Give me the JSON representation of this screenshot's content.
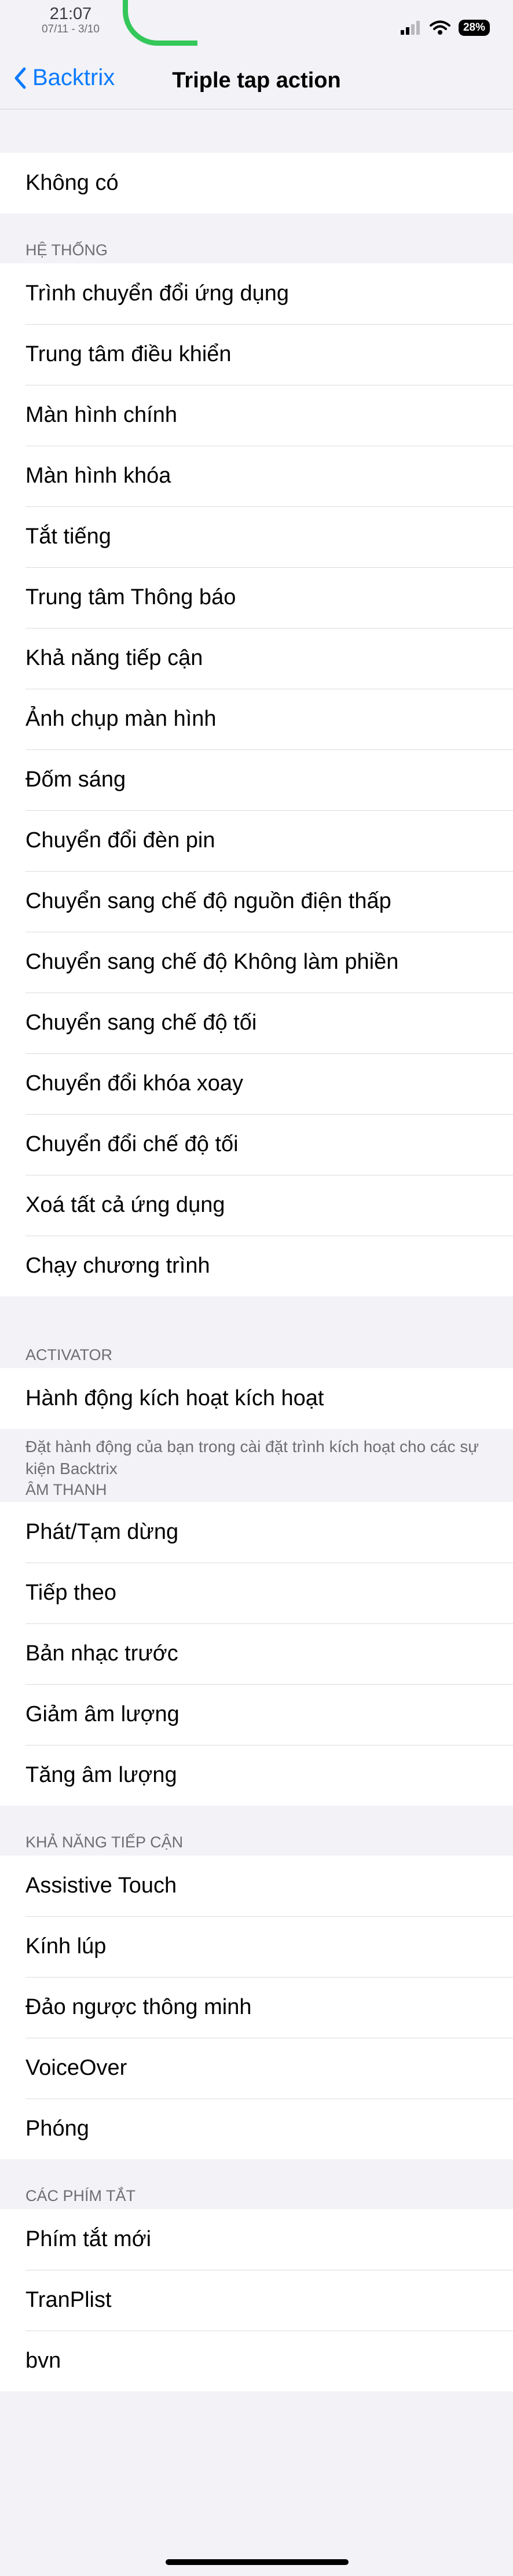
{
  "status_bar": {
    "time": "21:07",
    "date": "07/11 - 3/10",
    "battery": "28%"
  },
  "nav": {
    "back_label": "Backtrix",
    "title": "Triple tap action"
  },
  "top_group": {
    "items": [
      "Không có"
    ]
  },
  "sections": {
    "he_thong": {
      "header": "HỆ THỐNG",
      "items": [
        "Trình chuyển đổi ứng dụng",
        "Trung tâm điều khiển",
        "Màn hình chính",
        "Màn hình khóa",
        "Tắt tiếng",
        "Trung tâm Thông báo",
        "Khả năng tiếp cận",
        "Ảnh chụp màn hình",
        "Đốm sáng",
        "Chuyển đổi đèn pin",
        "Chuyển sang chế độ nguồn điện thấp",
        "Chuyển sang chế độ Không làm phiền",
        "Chuyển sang chế độ tối",
        "Chuyển đổi khóa xoay",
        "Chuyển đổi chế độ tối",
        "Xoá tất cả ứng dụng",
        "Chạy chương trình"
      ]
    },
    "activator": {
      "header": "ACTIVATOR",
      "items": [
        "Hành động kích hoạt kích hoạt"
      ],
      "footer": "Đặt hành động của bạn trong cài đặt trình kích hoạt cho các sự kiện Backtrix"
    },
    "am_thanh": {
      "header": "ÂM THANH",
      "items": [
        "Phát/Tạm dừng",
        "Tiếp theo",
        "Bản nhạc trước",
        "Giảm âm lượng",
        "Tăng âm lượng"
      ]
    },
    "kha_nang": {
      "header": "KHẢ NĂNG TIẾP CẬN",
      "items": [
        "Assistive Touch",
        "Kính lúp",
        "Đảo ngược thông minh",
        "VoiceOver",
        "Phóng"
      ]
    },
    "phim_tat": {
      "header": "CÁC PHÍM TẮT",
      "items": [
        "Phím tắt mới",
        "TranPlist",
        "bvn"
      ]
    }
  }
}
